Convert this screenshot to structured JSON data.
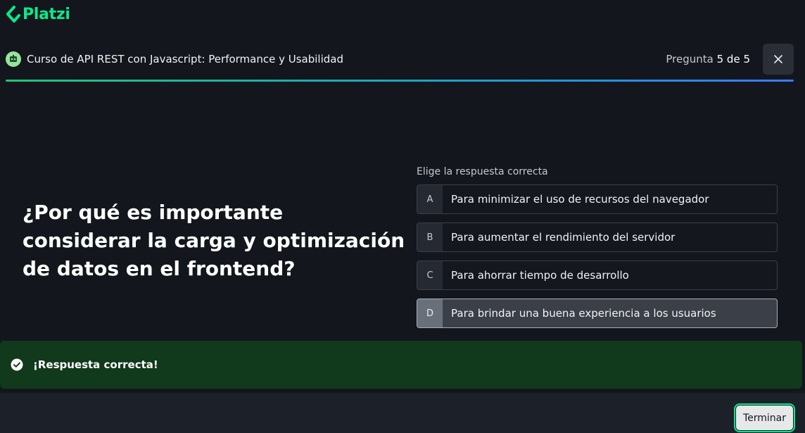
{
  "brand": {
    "logo_text": "Platzi",
    "color": "#0ae98a"
  },
  "header": {
    "course_icon": "course-badge-icon",
    "course_title": "Curso de API REST con Javascript: Performance y Usabilidad",
    "counter_prefix": "Pregunta",
    "current": "5",
    "counter_sep": "de",
    "total": "5",
    "close_icon": "close-icon",
    "progress": 1.0
  },
  "question": {
    "text": "¿Por qué es importante considerar la carga y optimización de datos en el frontend?"
  },
  "answers": {
    "instruction": "Elige la respuesta correcta",
    "options": [
      {
        "letter": "A",
        "text": "Para minimizar el uso de recursos del navegador",
        "selected": false
      },
      {
        "letter": "B",
        "text": "Para aumentar el rendimiento del servidor",
        "selected": false
      },
      {
        "letter": "C",
        "text": "Para ahorrar tiempo de desarrollo",
        "selected": false
      },
      {
        "letter": "D",
        "text": "Para brindar una buena experiencia a los usuarios",
        "selected": true
      }
    ]
  },
  "feedback": {
    "icon": "check-circle-icon",
    "text": "¡Respuesta correcta!",
    "color": "#11391c"
  },
  "footer": {
    "finish_label": "Terminar"
  }
}
